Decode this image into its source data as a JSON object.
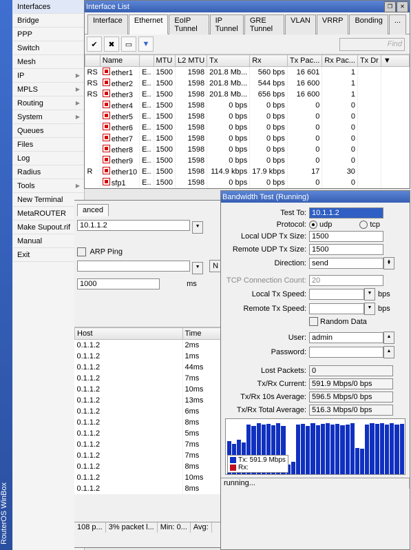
{
  "app": {
    "title": "RouterOS WinBox"
  },
  "sidebar": {
    "items": [
      {
        "label": "Interfaces",
        "arrow": false,
        "sel": true
      },
      {
        "label": "Bridge",
        "arrow": false
      },
      {
        "label": "PPP",
        "arrow": false
      },
      {
        "label": "Switch",
        "arrow": false
      },
      {
        "label": "Mesh",
        "arrow": false
      },
      {
        "label": "IP",
        "arrow": true
      },
      {
        "label": "MPLS",
        "arrow": true
      },
      {
        "label": "Routing",
        "arrow": true
      },
      {
        "label": "System",
        "arrow": true
      },
      {
        "label": "Queues",
        "arrow": false
      },
      {
        "label": "Files",
        "arrow": false
      },
      {
        "label": "Log",
        "arrow": false
      },
      {
        "label": "Radius",
        "arrow": false
      },
      {
        "label": "Tools",
        "arrow": true
      },
      {
        "label": "New Terminal",
        "arrow": false
      },
      {
        "label": "MetaROUTER",
        "arrow": false
      },
      {
        "label": "Make Supout.rif",
        "arrow": false
      },
      {
        "label": "Manual",
        "arrow": false
      },
      {
        "label": "Exit",
        "arrow": false
      }
    ]
  },
  "iface_win": {
    "title": "Interface List",
    "tabs": [
      "Interface",
      "Ethernet",
      "EoIP Tunnel",
      "IP Tunnel",
      "GRE Tunnel",
      "VLAN",
      "VRRP",
      "Bonding",
      "..."
    ],
    "active_tab": "Ethernet",
    "find": "Find",
    "cols": [
      "",
      "Name",
      "",
      "MTU",
      "L2 MTU",
      "Tx",
      "Rx",
      "Tx Pac...",
      "Rx Pac...",
      "Tx Dr"
    ],
    "rows": [
      {
        "f": "RS",
        "n": "ether1",
        "t": "E..",
        "m": "1500",
        "l": "1598",
        "tx": "201.8 Mb...",
        "rx": "560 bps",
        "tp": "16 601",
        "rp": "1"
      },
      {
        "f": "RS",
        "n": "ether2",
        "t": "E..",
        "m": "1500",
        "l": "1598",
        "tx": "201.8 Mb...",
        "rx": "544 bps",
        "tp": "16 600",
        "rp": "1"
      },
      {
        "f": "RS",
        "n": "ether3",
        "t": "E..",
        "m": "1500",
        "l": "1598",
        "tx": "201.8 Mb...",
        "rx": "656 bps",
        "tp": "16 600",
        "rp": "1"
      },
      {
        "f": "",
        "n": "ether4",
        "t": "E..",
        "m": "1500",
        "l": "1598",
        "tx": "0 bps",
        "rx": "0 bps",
        "tp": "0",
        "rp": "0"
      },
      {
        "f": "",
        "n": "ether5",
        "t": "E..",
        "m": "1500",
        "l": "1598",
        "tx": "0 bps",
        "rx": "0 bps",
        "tp": "0",
        "rp": "0"
      },
      {
        "f": "",
        "n": "ether6",
        "t": "E..",
        "m": "1500",
        "l": "1598",
        "tx": "0 bps",
        "rx": "0 bps",
        "tp": "0",
        "rp": "0"
      },
      {
        "f": "",
        "n": "ether7",
        "t": "E..",
        "m": "1500",
        "l": "1598",
        "tx": "0 bps",
        "rx": "0 bps",
        "tp": "0",
        "rp": "0"
      },
      {
        "f": "",
        "n": "ether8",
        "t": "E..",
        "m": "1500",
        "l": "1598",
        "tx": "0 bps",
        "rx": "0 bps",
        "tp": "0",
        "rp": "0"
      },
      {
        "f": "",
        "n": "ether9",
        "t": "E..",
        "m": "1500",
        "l": "1598",
        "tx": "0 bps",
        "rx": "0 bps",
        "tp": "0",
        "rp": "0"
      },
      {
        "f": "R",
        "n": "ether10",
        "t": "E..",
        "m": "1500",
        "l": "1598",
        "tx": "114.9 kbps",
        "rx": "17.9 kbps",
        "tp": "17",
        "rp": "30"
      },
      {
        "f": "",
        "n": "sfp1",
        "t": "E..",
        "m": "1500",
        "l": "1598",
        "tx": "0 bps",
        "rx": "0 bps",
        "tp": "0",
        "rp": "0"
      }
    ]
  },
  "tool_win": {
    "tab": "anced",
    "host": "10.1.1.2",
    "arp": "ARP Ping",
    "timeout": "1000",
    "ms": "ms",
    "ping_cols": [
      "Host",
      "Time"
    ],
    "pings": [
      {
        "h": "0.1.1.2",
        "t": "2ms"
      },
      {
        "h": "0.1.1.2",
        "t": "1ms"
      },
      {
        "h": "0.1.1.2",
        "t": "44ms"
      },
      {
        "h": "0.1.1.2",
        "t": "7ms"
      },
      {
        "h": "0.1.1.2",
        "t": "10ms"
      },
      {
        "h": "0.1.1.2",
        "t": "13ms"
      },
      {
        "h": "0.1.1.2",
        "t": "6ms"
      },
      {
        "h": "0.1.1.2",
        "t": "8ms"
      },
      {
        "h": "0.1.1.2",
        "t": "5ms"
      },
      {
        "h": "0.1.1.2",
        "t": "7ms"
      },
      {
        "h": "0.1.1.2",
        "t": "7ms"
      },
      {
        "h": "0.1.1.2",
        "t": "8ms"
      },
      {
        "h": "0.1.1.2",
        "t": "10ms"
      },
      {
        "h": "0.1.1.2",
        "t": "8ms"
      }
    ],
    "status": [
      "108 p...",
      "3% packet l...",
      "Min: 0...",
      "Avg:"
    ]
  },
  "bw_win": {
    "title": "Bandwidth Test (Running)",
    "labels": {
      "test_to": "Test To:",
      "protocol": "Protocol:",
      "udp": "udp",
      "tcp": "tcp",
      "loc_udp": "Local UDP Tx Size:",
      "rem_udp": "Remote UDP Tx Size:",
      "direction": "Direction:",
      "tcp_conn": "TCP Connection Count:",
      "loc_tx": "Local Tx Speed:",
      "rem_tx": "Remote Tx Speed:",
      "random": "Random Data",
      "user": "User:",
      "pass": "Password:",
      "lost": "Lost Packets:",
      "cur": "Tx/Rx Current:",
      "a10": "Tx/Rx 10s Average:",
      "tot": "Tx/Rx Total Average:",
      "bps": "bps"
    },
    "vals": {
      "test_to": "10.1.1.2",
      "loc_udp": "1500",
      "rem_udp": "1500",
      "direction": "send",
      "tcp_conn": "20",
      "user": "admin",
      "lost": "0",
      "cur": "591.9 Mbps/0 bps",
      "a10": "596.5 Mbps/0 bps",
      "tot": "516.3 Mbps/0 bps"
    },
    "legend": {
      "tx": "Tx: 591.9 Mbps",
      "rx": "Rx:"
    },
    "status": "running...",
    "bars": [
      60,
      55,
      62,
      58,
      90,
      88,
      92,
      90,
      91,
      89,
      92,
      88,
      18,
      22,
      90,
      91,
      88,
      92,
      89,
      91,
      92,
      90,
      91,
      89,
      90,
      92,
      48,
      46,
      90,
      92,
      91,
      93,
      90,
      92,
      90,
      91
    ]
  },
  "chart_data": {
    "type": "bar",
    "series": [
      {
        "name": "Tx",
        "unit": "Mbps",
        "values": [
          360,
          330,
          370,
          350,
          540,
          530,
          550,
          540,
          545,
          535,
          550,
          530,
          108,
          132,
          540,
          545,
          530,
          550,
          535,
          545,
          550,
          540,
          545,
          535,
          540,
          550,
          288,
          276,
          540,
          550,
          545,
          558,
          540,
          550,
          540,
          545
        ]
      },
      {
        "name": "Rx",
        "unit": "bps",
        "values": [
          0,
          0,
          0,
          0,
          0,
          0,
          0,
          0,
          0,
          0,
          0,
          0,
          0,
          0,
          0,
          0,
          0,
          0,
          0,
          0,
          0,
          0,
          0,
          0,
          0,
          0,
          0,
          0,
          0,
          0,
          0,
          0,
          0,
          0,
          0,
          0
        ]
      }
    ],
    "ylim": [
      0,
      600
    ],
    "legend": [
      "Tx: 591.9 Mbps",
      "Rx:"
    ]
  }
}
